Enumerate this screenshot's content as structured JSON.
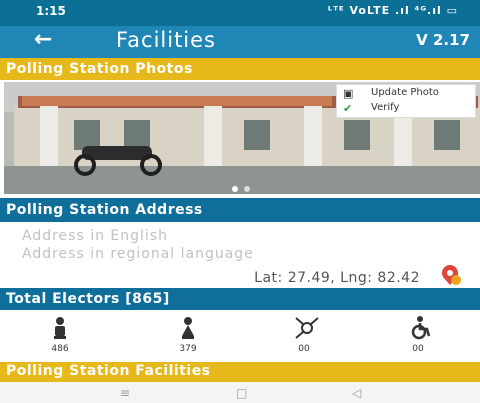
{
  "status_bar": {
    "time": "1:15",
    "icons": "ᴸᵀᴱ VoLTE .ıl ⁴ᴳ.ıl ▭"
  },
  "header": {
    "back_icon": "back-arrow-icon",
    "title": "Facilities",
    "version": "V 2.17"
  },
  "photos_section": {
    "title": "Polling Station Photos",
    "menu": [
      {
        "icon": "camera-icon",
        "label": "Update Photo"
      },
      {
        "icon": "checkmark-icon",
        "label": "Verify"
      }
    ]
  },
  "address_section": {
    "title": "Polling Station Address",
    "english_placeholder": "Address in English",
    "regional_placeholder": "Address in regional language",
    "latlng": "Lat: 27.49, Lng: 82.42",
    "pin_icon": "map-pin-icon"
  },
  "electors_section": {
    "title": "Total Electors [865]",
    "items": [
      {
        "icon": "male-icon",
        "count": "486"
      },
      {
        "icon": "female-icon",
        "count": "379"
      },
      {
        "icon": "third-gender-icon",
        "count": "00"
      },
      {
        "icon": "wheelchair-icon",
        "count": "00"
      }
    ]
  },
  "facilities_section": {
    "title": "Polling Station Facilities"
  },
  "nav": {
    "menu_icon": "≡",
    "home_icon": "□",
    "back_icon": "◁"
  },
  "colors": {
    "primary": "#1f86b6",
    "dark_primary": "#0b6f96",
    "accent": "#e6b81a",
    "section_blue": "#0f6f9a"
  }
}
